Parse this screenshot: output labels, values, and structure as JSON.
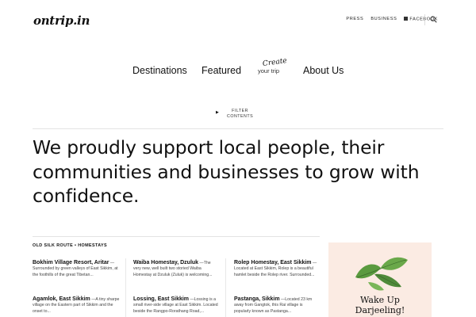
{
  "header": {
    "logo": "ontrip.in",
    "links": [
      "PRESS",
      "BUSINESS",
      "FACEBOOK"
    ]
  },
  "nav": {
    "items": [
      "Destinations",
      "Featured",
      "About Us"
    ],
    "create_top": "Create",
    "create_bottom": "your trip"
  },
  "filter": {
    "label_line1": "FILTER",
    "label_line2": "CONTENTS"
  },
  "hero": {
    "text": "We proudly support local people, their communities and businesses to grow with confidence."
  },
  "section": {
    "title": "OLD SILK ROUTE • HOMESTAYS",
    "cards": [
      {
        "title_part1": "Bokhim Village Resort, Aritar",
        "excerpt": " —Surrounded by green valleys of East Sikkim, at the foothills of the great Tibetan..."
      },
      {
        "title_part1": "Waiba Homestay, Dzuluk",
        "excerpt": " —The very new, well built two storied Waiba Homestay at Dzuluk (Zuluk) is welcoming..."
      },
      {
        "title_part1": "Rolep Homestay, East Sikkim",
        "excerpt": " —Located at East Sikkim, Rolep is a beautiful hamlet beside the Rolep river. Surrounded..."
      },
      {
        "title_part1": "Agamlok, East Sikkim",
        "excerpt": " —A tiny sharpe village on the Eastern part of Sikkim and the onset to..."
      },
      {
        "title_part1": "Lossing, East Sikkim",
        "excerpt": " —Lossing is a small river-side village at East Sikkim. Located beside the Rangpo-Rorathang Road,..."
      },
      {
        "title_part1": "Pastanga, Sikkim",
        "excerpt": " —Located 23 km away from Gangtok, this Rai village is popularly known as Pastanga..."
      }
    ]
  },
  "ad": {
    "line1": "Wake Up",
    "line2": "Darjeeling!",
    "bg_color": "#fbebe3",
    "leaf_color": "#4f8a3a"
  }
}
